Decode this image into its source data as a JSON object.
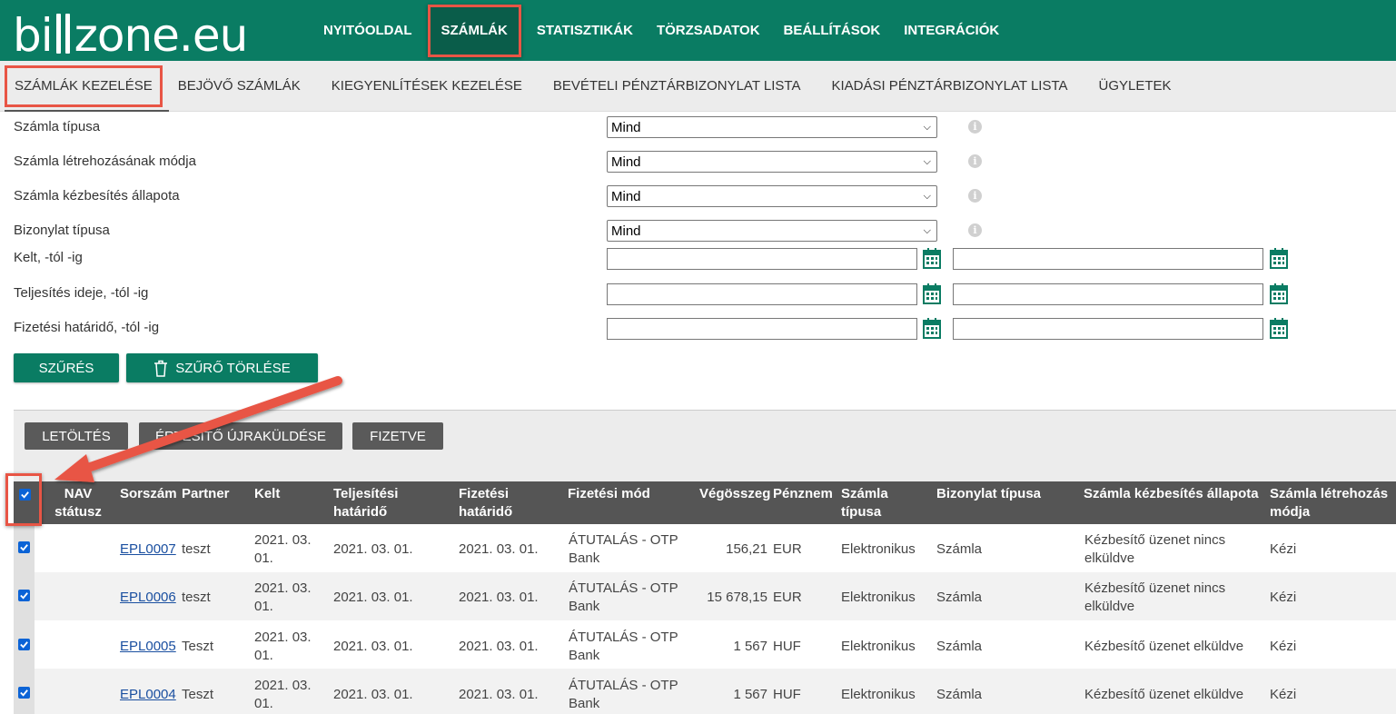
{
  "app": {
    "logo": "billzone.eu"
  },
  "main_nav": [
    {
      "label": "NYITÓOLDAL",
      "active": false
    },
    {
      "label": "SZÁMLÁK",
      "active": true
    },
    {
      "label": "STATISZTIKÁK",
      "active": false
    },
    {
      "label": "TÖRZSADATOK",
      "active": false
    },
    {
      "label": "BEÁLLÍTÁSOK",
      "active": false
    },
    {
      "label": "INTEGRÁCIÓK",
      "active": false
    }
  ],
  "sub_nav": [
    {
      "label": "SZÁMLÁK KEZELÉSE",
      "active": true
    },
    {
      "label": "BEJÖVŐ SZÁMLÁK",
      "active": false
    },
    {
      "label": "KIEGYENLÍTÉSEK KEZELÉSE",
      "active": false
    },
    {
      "label": "BEVÉTELI PÉNZTÁRBIZONYLAT LISTA",
      "active": false
    },
    {
      "label": "KIADÁSI PÉNZTÁRBIZONYLAT LISTA",
      "active": false
    },
    {
      "label": "ÜGYLETEK",
      "active": false
    }
  ],
  "filters": {
    "selects": [
      {
        "label": "Számla típusa",
        "value": "Mind"
      },
      {
        "label": "Számla létrehozásának módja",
        "value": "Mind"
      },
      {
        "label": "Számla kézbesítés állapota",
        "value": "Mind"
      },
      {
        "label": "Bizonylat típusa",
        "value": "Mind"
      }
    ],
    "ranges": [
      {
        "label": "Kelt, -tól -ig",
        "from": "",
        "to": ""
      },
      {
        "label": "Teljesítés ideje, -tól -ig",
        "from": "",
        "to": ""
      },
      {
        "label": "Fizetési határidő, -tól -ig",
        "from": "",
        "to": ""
      }
    ],
    "info_glyph": "i",
    "filter_button": "SZŰRÉS",
    "clear_button": "SZŰRŐ TÖRLÉSE"
  },
  "actions": {
    "download": "LETÖLTÉS",
    "resend": "ÉRTESÍTŐ ÚJRAKÜLDÉSE",
    "paid": "FIZETVE"
  },
  "table": {
    "header_checkbox_checked": true,
    "columns": [
      "NAV státusz",
      "Sorszám",
      "Partner",
      "Kelt",
      "Teljesítési határidő",
      "Fizetési határidő",
      "Fizetési mód",
      "Végösszeg",
      "Pénznem",
      "Számla típusa",
      "Bizonylat típusa",
      "Számla kézbesítés állapota",
      "Számla létrehozás módja"
    ],
    "rows": [
      {
        "checked": true,
        "nav": "",
        "number": "EPL0007",
        "partner": "teszt",
        "date": "2021. 03. 01.",
        "fulfil": "2021. 03. 01.",
        "due": "2021. 03. 01.",
        "payment": "ÁTUTALÁS - OTP Bank",
        "total": "156,21",
        "currency": "EUR",
        "type": "Elektronikus",
        "doc_type": "Számla",
        "delivery": "Kézbesítő üzenet nincs elküldve",
        "created": "Kézi"
      },
      {
        "checked": true,
        "nav": "",
        "number": "EPL0006",
        "partner": "teszt",
        "date": "2021. 03. 01.",
        "fulfil": "2021. 03. 01.",
        "due": "2021. 03. 01.",
        "payment": "ÁTUTALÁS - OTP Bank",
        "total": "15 678,15",
        "currency": "EUR",
        "type": "Elektronikus",
        "doc_type": "Számla",
        "delivery": "Kézbesítő üzenet nincs elküldve",
        "created": "Kézi"
      },
      {
        "checked": true,
        "nav": "",
        "number": "EPL0005",
        "partner": "Teszt",
        "date": "2021. 03. 01.",
        "fulfil": "2021. 03. 01.",
        "due": "2021. 03. 01.",
        "payment": "ÁTUTALÁS - OTP Bank",
        "total": "1 567",
        "currency": "HUF",
        "type": "Elektronikus",
        "doc_type": "Számla",
        "delivery": "Kézbesítő üzenet elküldve",
        "created": "Kézi"
      },
      {
        "checked": true,
        "nav": "",
        "number": "EPL0004",
        "partner": "Teszt",
        "date": "2021. 03. 01.",
        "fulfil": "2021. 03. 01.",
        "due": "2021. 03. 01.",
        "payment": "ÁTUTALÁS - OTP Bank",
        "total": "1 567",
        "currency": "HUF",
        "type": "Elektronikus",
        "doc_type": "Számla",
        "delivery": "Kézbesítő üzenet elküldve",
        "created": "Kézi"
      }
    ]
  },
  "colors": {
    "brand_green": "#0a7c63",
    "highlight_red": "#e85545",
    "header_gray": "#555555",
    "link_blue": "#1a4fa0"
  },
  "icons": {
    "filter_calendar": "calendar-icon",
    "clear_filter": "trash-icon",
    "field_help": "info-icon",
    "select_toggle": "chevron-down-icon",
    "callout": "annotation-arrow",
    "row_selected": "checkbox-checked-icon"
  }
}
